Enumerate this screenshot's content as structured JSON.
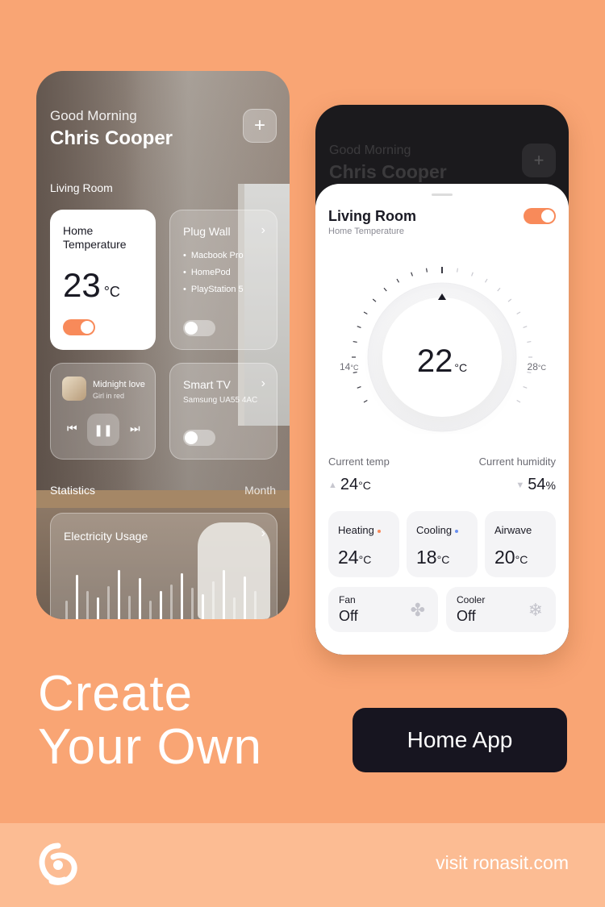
{
  "left_phone": {
    "greeting": "Good Morning",
    "user_name": "Chris Cooper",
    "add_button": "+",
    "room_label": "Living Room",
    "home_temperature": {
      "title": "Home Temperature",
      "value": "23",
      "unit": "°C",
      "toggle_on": true
    },
    "plug_wall": {
      "title": "Plug Wall",
      "items": [
        "Macbook Pro",
        "HomePod",
        "PlayStation 5"
      ],
      "toggle_on": false
    },
    "music": {
      "song": "Midnight love",
      "artist": "Girl in red"
    },
    "smart_tv": {
      "title": "Smart TV",
      "model": "Samsung UA55 4AC",
      "toggle_on": false
    },
    "statistics_label": "Statistics",
    "period_label": "Month",
    "electricity": {
      "title": "Electricity Usage"
    }
  },
  "right_phone": {
    "ghost_greeting": "Good Morning",
    "ghost_name": "Chris Cooper",
    "title": "Living Room",
    "subtitle": "Home Temperature",
    "toggle_on": true,
    "dial": {
      "value": "22",
      "unit": "°C",
      "min": "14",
      "max": "28",
      "min_unit": "°C",
      "max_unit": "°C"
    },
    "current_temp": {
      "label": "Current temp",
      "value": "24",
      "unit": "°C"
    },
    "current_humidity": {
      "label": "Current humidity",
      "value": "54",
      "unit": "%"
    },
    "modes": [
      {
        "label": "Heating",
        "value": "24",
        "unit": "°C",
        "dot_color": "#f88a5a"
      },
      {
        "label": "Cooling",
        "value": "18",
        "unit": "°C",
        "dot_color": "#6a8ff0"
      },
      {
        "label": "Airwave",
        "value": "20",
        "unit": "°C"
      }
    ],
    "devices": [
      {
        "label": "Fan",
        "state": "Off",
        "icon": "fan-icon"
      },
      {
        "label": "Cooler",
        "state": "Off",
        "icon": "snowflake-icon"
      }
    ]
  },
  "headline": {
    "line1": "Create",
    "line2": "Your Own"
  },
  "cta_label": "Home App",
  "footer": {
    "visit_text": "visit ronasit.com"
  },
  "colors": {
    "background": "#f9a574",
    "accent": "#f88a5a",
    "cta": "#171520",
    "footer": "#fcbc93"
  }
}
